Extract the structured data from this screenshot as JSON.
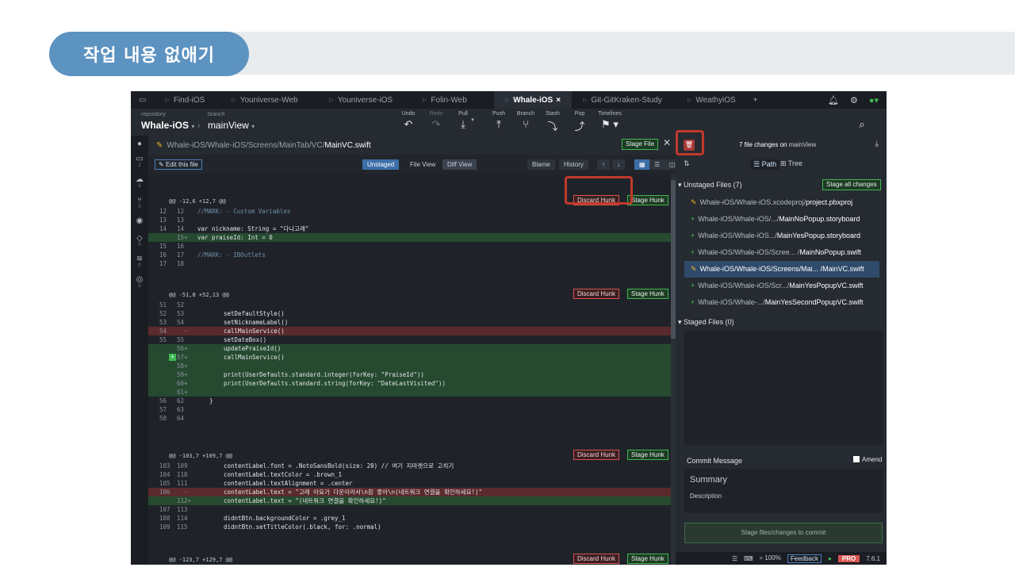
{
  "slide": {
    "title": "작업 내용 없애기"
  },
  "tabs": [
    {
      "label": "Find-iOS"
    },
    {
      "label": "Youniverse-Web"
    },
    {
      "label": "Youniverse-iOS"
    },
    {
      "label": "Folin-Web"
    },
    {
      "label": "Whale-iOS",
      "active": true
    },
    {
      "label": "Git-GitKraken-Study"
    },
    {
      "label": "WeathyiOS"
    }
  ],
  "tab_close": "×",
  "tab_add": "+",
  "toolbar": {
    "repo_label": "repository",
    "repo_value": "Whale-iOS",
    "branch_label": "branch",
    "branch_value": "mainView",
    "undo": "Undo",
    "redo": "Redo",
    "pull": "Pull",
    "push": "Push",
    "branch": "Branch",
    "stash": "Stash",
    "pop": "Pop",
    "timelines": "Timelines"
  },
  "left_badges": {
    "remote": "2",
    "cloud": "5",
    "pr": "0",
    "tags": "0",
    "submodules": "0",
    "gitflow": "0"
  },
  "diff": {
    "path_prefix": "Whale-iOS/Whale-iOS/Screens/MainTab/VC/",
    "file_name": "MainVC.swift",
    "stage_file": "Stage File",
    "edit_file": "Edit this file",
    "unstaged": "Unstaged",
    "file_view": "File View",
    "diff_view": "Diff View",
    "blame": "Blame",
    "history": "History",
    "discard_hunk": "Discard Hunk",
    "stage_hunk": "Stage Hunk",
    "hunk1_header": "@@ -12,6 +12,7 @@",
    "hunk2_header": "@@ -51,8 +52,13 @@",
    "hunk3_header": "@@ -103,7 +109,7 @@",
    "hunk4_header": "@@ -123,7 +129,7 @@"
  },
  "right": {
    "changes_text": "7 file changes on",
    "changes_branch": "mainView",
    "path_toggle": "Path",
    "tree_toggle": "Tree",
    "unstaged_title": "Unstaged Files (7)",
    "stage_all": "Stage all changes",
    "files": [
      {
        "prefix": "Whale-iOS/Whale-iOS.xcodeproj/",
        "name": "project.pbxproj",
        "type": "modified"
      },
      {
        "prefix": "Whale-iOS/Whale-iOS/.../",
        "name": "MainNoPopup.storyboard",
        "type": "added"
      },
      {
        "prefix": "Whale-iOS/Whale-iOS.../",
        "name": "MainYesPopup.storyboard",
        "type": "added"
      },
      {
        "prefix": "Whale-iOS/Whale-iOS/Scree... /",
        "name": "MainNoPopup.swift",
        "type": "added"
      },
      {
        "prefix": "Whale-iOS/Whale-iOS/Screens/Mai... /",
        "name": "MainVC.swift",
        "type": "modified",
        "selected": true
      },
      {
        "prefix": "Whale-iOS/Whale-iOS/Scr.../",
        "name": "MainYesPopupVC.swift",
        "type": "added"
      },
      {
        "prefix": "Whale-iOS/Whale-.../",
        "name": "MainYesSecondPopupVC.swift",
        "type": "added"
      }
    ],
    "staged_title": "Staged Files (0)",
    "commit_message": "Commit Message",
    "amend": "Amend",
    "summary": "Summary",
    "description": "Description",
    "commit_button": "Stage files/changes to commit"
  },
  "status": {
    "zoom": "100%",
    "feedback": "Feedback",
    "pro": "PRO",
    "version": "7.6.1"
  },
  "code_lines": {
    "l1": "//MARK: - Custom Variables",
    "l2": "var nickname: String = \"다나고래\"",
    "l3": "var praiseId: Int = 0",
    "l4": "//MARK: - IBOutlets",
    "l5": "setDefaultStyle()",
    "l6": "setNicknameLabel()",
    "l7": "callMainService()",
    "l8": "setDateBox()",
    "l9": "updatePraiseId()",
    "l10": "callMainService()",
    "l11": "print(UserDefaults.standard.integer(forKey: \"PraiseId\"))",
    "l12": "print(UserDefaults.standard.string(forKey: \"DateLastVisited\"))",
    "l13": "}",
    "l14": "contentLabel.font = .NotoSansBold(size: 20) // 여기 지마켓으로 고치기",
    "l15": "contentLabel.textColor = .brown_1",
    "l16": "contentLabel.textAlignment = .center",
    "l17": "contentLabel.text = \"고래 아요가 다운이라서\\n참 좋아\\n(네트워크 연결을 확인하세요!)\"",
    "l18": "contentLabel.text = \"(네트워크 연결을 확인하세요!)\"",
    "l19": "didntBtn.backgroundColor = .grey_1",
    "l20": "didntBtn.setTitleColor(.black, for: .normal)"
  }
}
